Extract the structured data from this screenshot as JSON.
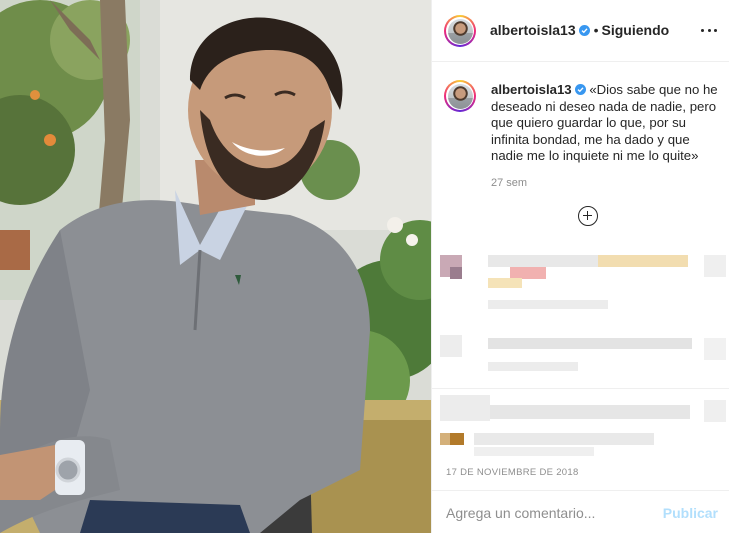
{
  "post": {
    "photo_icon": "post-photo-man-smiling-grey-sweater",
    "author": {
      "username": "albertoisla13",
      "verified_icon": "verified-badge-icon",
      "follow_status": "Siguiendo",
      "separator": "•"
    },
    "more_icon": "more-options-icon",
    "caption": {
      "username": "albertoisla13",
      "text": "«Dios sabe que no he deseado ni deseo nada de nadie, pero que quiero guardar lo que, por su infinita bondad, me ha dado y que nadie me lo inquiete ni me lo quite»",
      "time_ago": "27 sem"
    },
    "load_more_icon": "plus-circle-icon",
    "date": "17 DE NOVIEMBRE DE 2018",
    "comment_box": {
      "placeholder": "Agrega un comentario...",
      "publish_label": "Publicar"
    }
  },
  "colors": {
    "link_blue": "#3897f0",
    "disabled_blue": "#b2dffc",
    "text": "#262626",
    "secondary_text": "#8e8e8e",
    "border": "#efefef"
  }
}
